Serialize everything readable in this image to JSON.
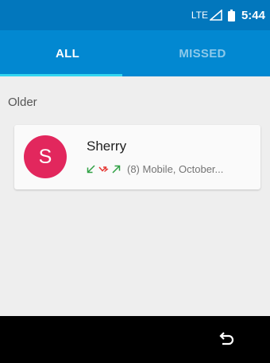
{
  "status_bar": {
    "network": "LTE",
    "time": "5:44",
    "icons": [
      "signal-icon",
      "battery-icon"
    ]
  },
  "tabs": [
    {
      "label": "ALL",
      "selected": true
    },
    {
      "label": "MISSED",
      "selected": false
    }
  ],
  "call_log": {
    "section": "Older",
    "entries": [
      {
        "avatar_letter": "S",
        "avatar_color": "#e2275d",
        "name": "Sherry",
        "call_types": [
          "incoming-call-icon",
          "missed-call-icon",
          "outgoing-call-icon"
        ],
        "summary": "(8) Mobile, October..."
      }
    ]
  },
  "nav_bar": {
    "icons": [
      "back-icon"
    ]
  },
  "colors": {
    "status_bar": "#0277bd",
    "tab_bar": "#0288d1",
    "tab_indicator": "#33d6f0",
    "incoming": "#2ea043",
    "missed": "#e53935"
  }
}
